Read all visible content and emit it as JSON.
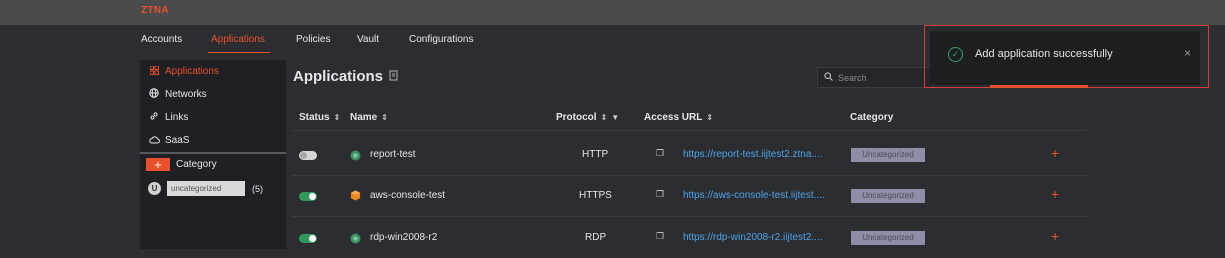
{
  "brand": "ZTNA",
  "nav": [
    "Accounts",
    "Applications",
    "Policies",
    "Vault",
    "Configurations"
  ],
  "sidebar": {
    "items": [
      {
        "label": "Applications",
        "icon": "grid-icon"
      },
      {
        "label": "Networks",
        "icon": "globe-icon"
      },
      {
        "label": "Links",
        "icon": "link-icon"
      },
      {
        "label": "SaaS",
        "icon": "cloud-icon"
      }
    ],
    "category_label": "Category",
    "category_add": "+",
    "category_avatar": "U",
    "category_value": "uncategorized",
    "category_count": "(5)"
  },
  "main": {
    "title": "Applications",
    "search_placeholder": "Search"
  },
  "table": {
    "headers": [
      "Status",
      "Name",
      "Protocol",
      "Access URL",
      "Category"
    ],
    "rows": [
      {
        "status": "off",
        "name": "report-test",
        "protocol": "HTTP",
        "url": "https://report-test.iijtest2.ztna....",
        "category": "Uncategorized",
        "icon": "green-circle-icon"
      },
      {
        "status": "on",
        "name": "aws-console-test",
        "protocol": "HTTPS",
        "url": "https://aws-console-test.iijtest....",
        "category": "Uncategorized",
        "icon": "orange-cube-icon"
      },
      {
        "status": "on",
        "name": "rdp-win2008-r2",
        "protocol": "RDP",
        "url": "https://rdp-win2008-r2.iijtest2....",
        "category": "Uncategorized",
        "icon": "green-circle-icon"
      }
    ]
  },
  "toast": {
    "message": "Add application successfully",
    "close": "×"
  },
  "colors": {
    "accent": "#e8502a",
    "success": "#2f9a5c",
    "link": "#4ea3e6"
  }
}
